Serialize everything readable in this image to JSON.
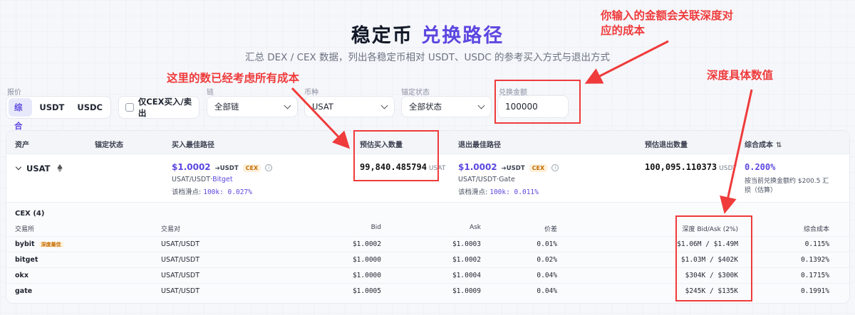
{
  "hero": {
    "title_main": "稳定币 ",
    "title_accent": "兑换路径",
    "subtitle": "汇总 DEX / CEX 数据，列出各稳定币相对 USDT、USDC 的参考买入方式与退出方式"
  },
  "filters": {
    "quote_label": "报价",
    "quote_options": [
      "综合",
      "USDT",
      "USDC"
    ],
    "cex_only_label": "仅CEX买入/卖出",
    "chain_label": "链",
    "chain_value": "全部链",
    "coin_label": "币种",
    "coin_value": "USAT",
    "peg_label": "锚定状态",
    "peg_value": "全部状态",
    "amount_label": "兑换金额",
    "amount_value": "100000"
  },
  "table": {
    "headers": {
      "asset": "资产",
      "peg": "锚定状态",
      "buy_route": "买入最佳路径",
      "est_buy": "预估买入数量",
      "exit_route": "退出最佳路径",
      "est_exit": "预估退出数量",
      "total_cost": "综合成本",
      "sort_icon": "⇅"
    },
    "row": {
      "asset": "USAT",
      "buy_price": "$1.0002",
      "buy_to": "➔USDT",
      "buy_tag": "CEX",
      "buy_pair": "USAT/USDT",
      "buy_venue": "Bitget",
      "buy_slip_label": "该档滑点:",
      "buy_slip_value": "100k: 0.027%",
      "est_buy_value": "99,840.485794",
      "est_buy_unit": "USAT",
      "exit_price": "$1.0002",
      "exit_to": "➔USDT",
      "exit_tag": "CEX",
      "exit_pair": "USAT/USDT",
      "exit_venue": "Gate",
      "exit_slip_label": "该档滑点:",
      "exit_slip_value": "100k: 0.011%",
      "est_exit_value": "100,095.110373",
      "est_exit_unit": "USDT",
      "total_cost": "0.200%",
      "cost_note_1": "按当前兑换金额约 $200.5 汇",
      "cost_note_2": "损（估算）"
    }
  },
  "cex": {
    "title": "CEX (4)",
    "headers": {
      "exchange": "交易所",
      "pair": "交易对",
      "bid": "Bid",
      "ask": "Ask",
      "spread": "价差",
      "depth": "深度 Bid/Ask (2%)",
      "cost": "综合成本"
    },
    "best_tag": "深度最佳",
    "rows": [
      {
        "exchange": "bybit",
        "pair": "USAT/USDT",
        "bid": "$1.0002",
        "ask": "$1.0003",
        "spread": "0.01%",
        "depth_bid": "$1.06M",
        "depth_ask": "$1.49M",
        "cost": "0.115%"
      },
      {
        "exchange": "bitget",
        "pair": "USAT/USDT",
        "bid": "$1.0000",
        "ask": "$1.0002",
        "spread": "0.02%",
        "depth_bid": "$1.03M",
        "depth_ask": "$402K",
        "cost": "0.1392%"
      },
      {
        "exchange": "okx",
        "pair": "USAT/USDT",
        "bid": "$1.0000",
        "ask": "$1.0004",
        "spread": "0.04%",
        "depth_bid": "$304K",
        "depth_ask": "$300K",
        "cost": "0.1715%"
      },
      {
        "exchange": "gate",
        "pair": "USAT/USDT",
        "bid": "$1.0005",
        "ask": "$1.0009",
        "spread": "0.04%",
        "depth_bid": "$245K",
        "depth_ask": "$135K",
        "cost": "0.1991%"
      }
    ]
  },
  "annotations": {
    "cost_note": "这里的数已经考虑所有成本",
    "amount_note_1": "你输入的金额会关联深度对",
    "amount_note_2": "应的成本",
    "depth_note": "深度具体数值"
  },
  "colors": {
    "accent": "#5b47e0",
    "annotation": "#ef3b3b",
    "tag": "#c46b00"
  }
}
